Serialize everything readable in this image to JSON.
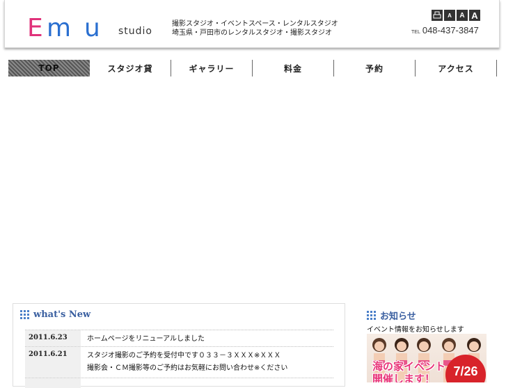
{
  "header": {
    "logo_text": "Emu",
    "logo_sub": "studio",
    "tagline": "撮影スタジオ・イベントスペース・レンタルスタジオ\n埼玉県・戸田市のレンタルスタジオ・撮影スタジオ",
    "font_size_buttons": [
      "",
      "A",
      "A",
      "A"
    ],
    "phone_prefix": "TEL",
    "phone": "048-437-3847"
  },
  "nav": {
    "items": [
      {
        "label": "TOP"
      },
      {
        "label": "スタジオ貸"
      },
      {
        "label": "ギャラリー"
      },
      {
        "label": "料金"
      },
      {
        "label": "予約"
      },
      {
        "label": "アクセス"
      }
    ]
  },
  "news": {
    "title": "what's New",
    "rows": [
      {
        "date": "2011.6.23",
        "text": "ホームページをリニューアルしました"
      },
      {
        "date": "2011.6.21",
        "text": "スタジオ撮影のご予約を受付中です０３３－３ＸＸＸ※ＸＸＸ\n撮影会・ＣＭ撮影等のご予約はお気軽にお問い合わせ※ください"
      }
    ]
  },
  "notice": {
    "title": "お知らせ",
    "subtitle": "イベント情報をお知らせします",
    "banner_headline": "海の家イベント\n開催します！",
    "banner_date": "7/26"
  },
  "colors": {
    "accent_blue": "#3a5fa0",
    "logo_pink": "#e0327a",
    "logo_blue": "#2a6fd0",
    "badge_red": "#d8232a"
  }
}
